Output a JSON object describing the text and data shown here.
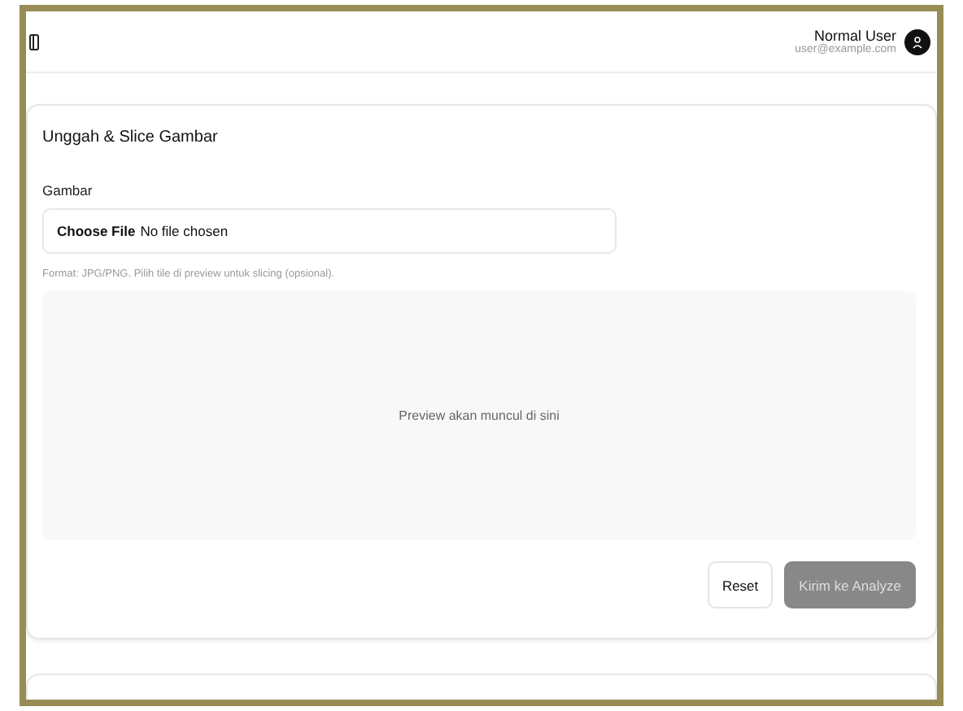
{
  "header": {
    "user_name": "Normal User",
    "user_email": "user@example.com"
  },
  "card": {
    "title": "Unggah & Slice Gambar",
    "field_label": "Gambar",
    "file_button": "Choose File",
    "file_status": "No file chosen",
    "hint": "Format: JPG/PNG. Pilih tile di preview untuk slicing (opsional).",
    "preview_text": "Preview akan muncul di sini",
    "buttons": [
      {
        "label": "Reset",
        "kind": "outline",
        "disabled": false
      },
      {
        "label": "Kirim ke Analyze",
        "kind": "primary",
        "disabled": true
      }
    ]
  }
}
